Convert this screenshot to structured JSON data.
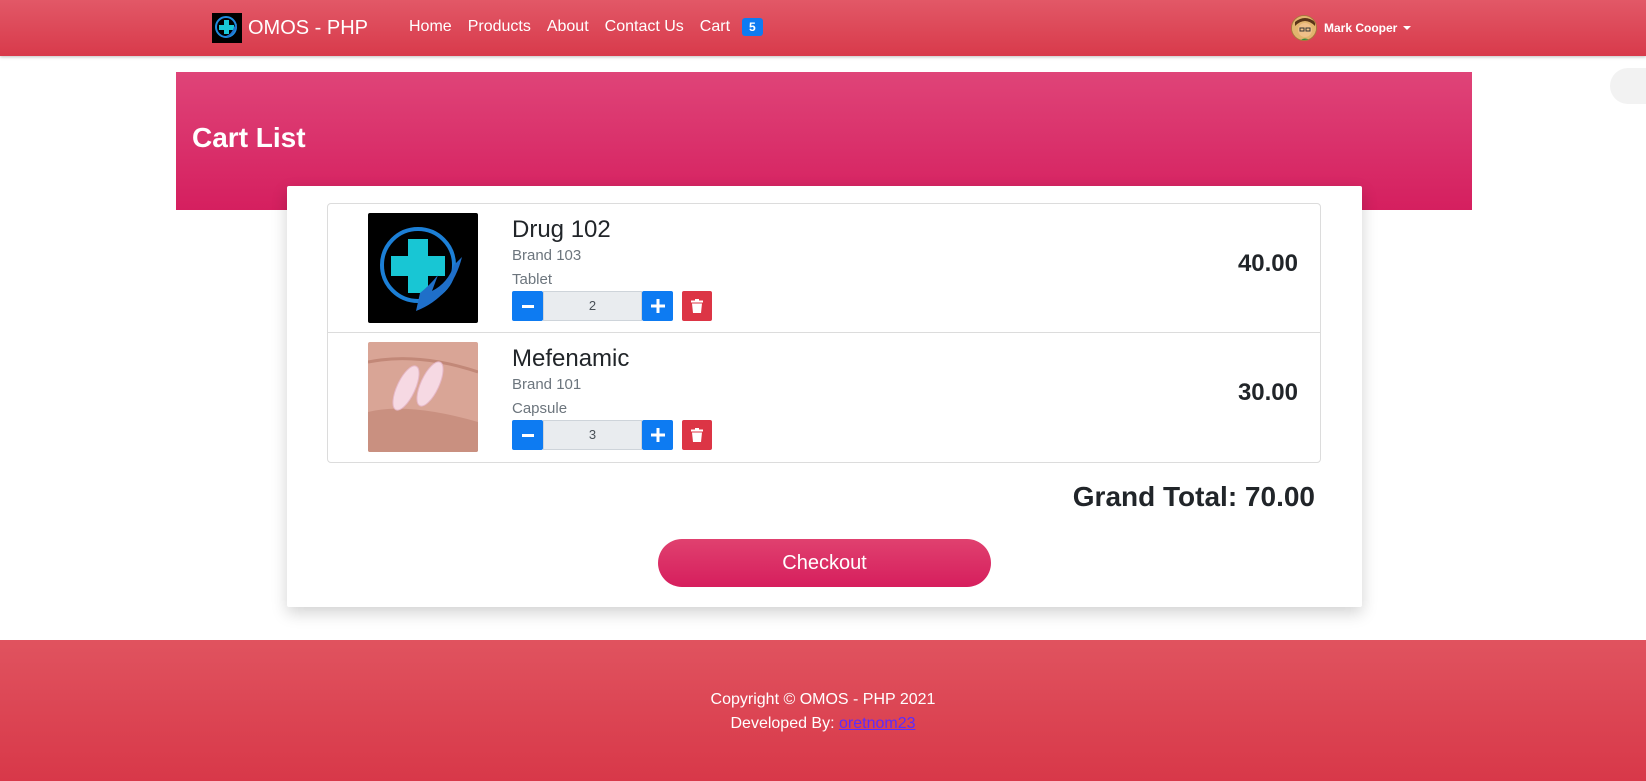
{
  "nav": {
    "brand": "OMOS - PHP",
    "links": [
      "Home",
      "Products",
      "About",
      "Contact Us",
      "Cart"
    ],
    "cart_count": "5",
    "user_name": "Mark Cooper"
  },
  "header": {
    "title": "Cart List"
  },
  "cart": {
    "items": [
      {
        "name": "Drug 102",
        "brand": "Brand 103",
        "type": "Tablet",
        "quantity": "2",
        "price": "40.00"
      },
      {
        "name": "Mefenamic",
        "brand": "Brand 101",
        "type": "Capsule",
        "quantity": "3",
        "price": "30.00"
      }
    ],
    "grand_total": "Grand Total: 70.00",
    "checkout_label": "Checkout"
  },
  "footer": {
    "copyright": "Copyright © OMOS - PHP 2021",
    "developed_by": "Developed By:",
    "developer": "oretnom23"
  },
  "colors": {
    "primary_red": "#d83a4b",
    "header_pink": "#d51f5f",
    "accent_blue": "#0d7bf2",
    "danger": "#dc3545"
  }
}
